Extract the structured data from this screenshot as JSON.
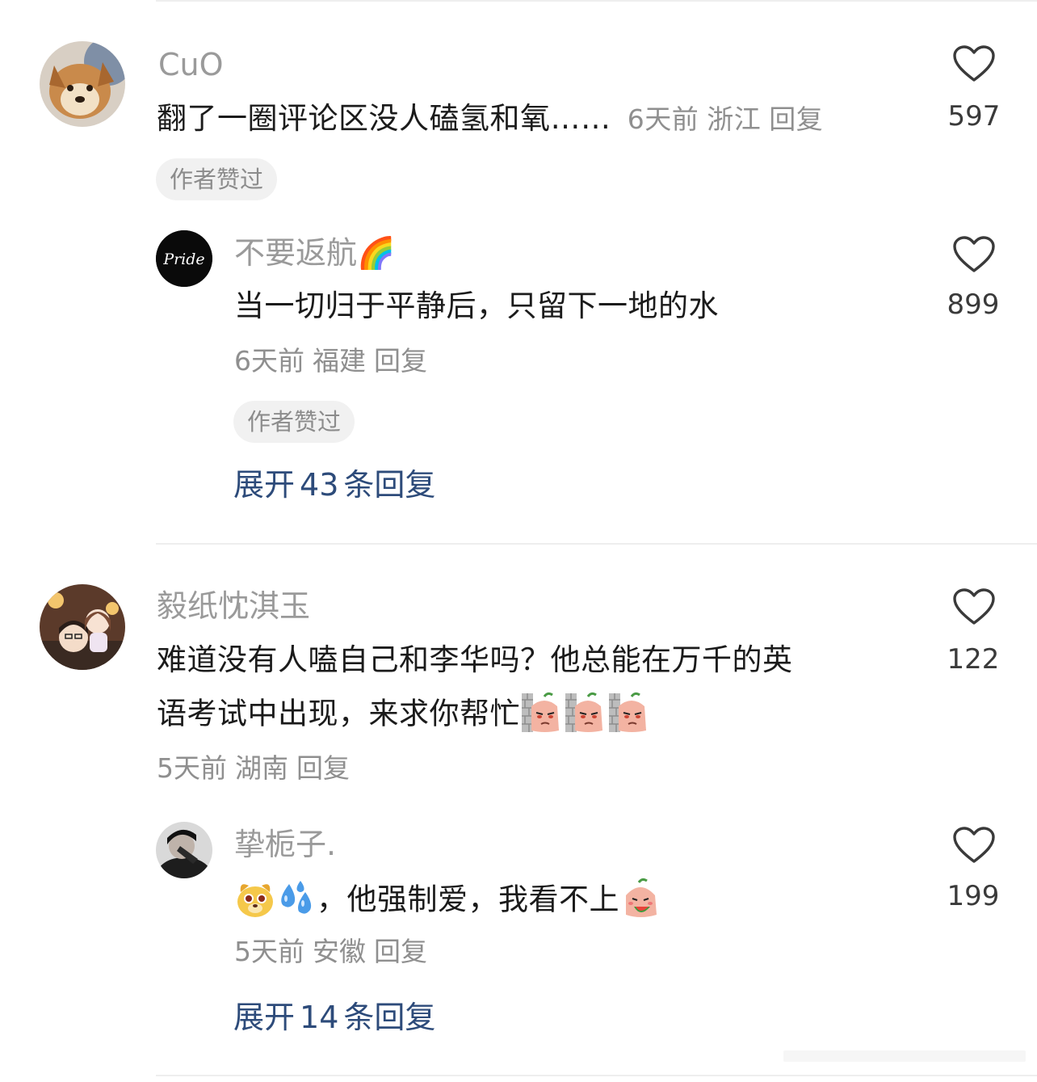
{
  "comments": [
    {
      "username": "CuO",
      "text": "翻了一圈评论区没人磕氢和氧……",
      "time": "6天前",
      "location": "浙江",
      "reply_label": "回复",
      "badge": "作者赞过",
      "likes": "597",
      "reply": {
        "username": "不要返航🌈",
        "avatar_text": "Pride",
        "text": "当一切归于平静后，只留下一地的水",
        "time": "6天前",
        "location": "福建",
        "reply_label": "回复",
        "badge": "作者赞过",
        "likes": "899"
      },
      "expand": {
        "prefix": "展开",
        "count": "43",
        "suffix": "条回复"
      }
    },
    {
      "username": "毅纸忱淇玉",
      "text_line1": "难道没有人嗑自己和李华吗？他总能在万千的英",
      "text_line2": "语考试中出现，来求你帮忙",
      "time": "5天前",
      "location": "湖南",
      "reply_label": "回复",
      "likes": "122",
      "reply": {
        "username": "挚栀子.",
        "text": "，他强制爱，我看不上",
        "time": "5天前",
        "location": "安徽",
        "reply_label": "回复",
        "likes": "199"
      },
      "expand": {
        "prefix": "展开",
        "count": "14",
        "suffix": "条回复"
      }
    }
  ],
  "colors": {
    "link": "#2d4b7a",
    "meta": "#8f8f8f",
    "badge_bg": "#f1f1f1"
  },
  "icons": [
    "heart-outline-icon",
    "rainbow-emoji",
    "peeking-sweet-potato-emoji",
    "dog-face-emoji",
    "sweat-drops-emoji",
    "watermelon-potato-emoji"
  ]
}
